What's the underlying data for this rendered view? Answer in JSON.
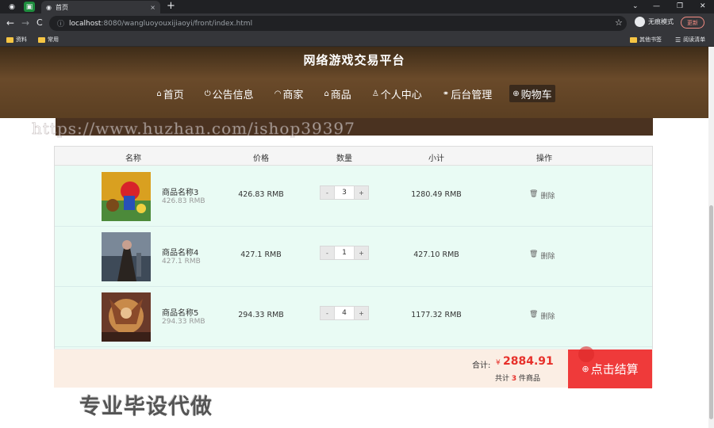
{
  "browser": {
    "tab_title": "首页",
    "tab_close": "×",
    "new_tab": "+",
    "url_host": "localhost",
    "url_path": ":8080/wangluoyouxijiaoyi/front/index.html",
    "star": "☆",
    "incognito_label": "无痕模式",
    "update_label": "更新",
    "window_controls": [
      "⌄",
      "—",
      "❐",
      "✕"
    ],
    "nav": {
      "back": "←",
      "forward": "→",
      "reload": "C",
      "info": "ⓘ"
    },
    "bookmarks": [
      {
        "label": "资料"
      },
      {
        "label": "常用"
      }
    ],
    "bookmarks_right": [
      {
        "label": "其他书签"
      },
      {
        "label": "阅读清单"
      }
    ]
  },
  "site": {
    "title": "网络游戏交易平台",
    "nav": [
      {
        "icon": "⌂",
        "label": "首页"
      },
      {
        "icon": "⏻",
        "label": "公告信息"
      },
      {
        "icon": "◠",
        "label": "商家"
      },
      {
        "icon": "⌂",
        "label": "商品"
      },
      {
        "icon": "♙",
        "label": "个人中心"
      },
      {
        "icon": "⚭",
        "label": "后台管理"
      },
      {
        "icon": "⊕",
        "label": "购物车"
      }
    ],
    "watermark": "https://www.huzhan.com/ishop39397"
  },
  "cart": {
    "headers": {
      "name": "名称",
      "price": "价格",
      "qty": "数量",
      "subtotal": "小计",
      "action": "操作"
    },
    "items": [
      {
        "name": "商品名称3",
        "unit": "426.83 RMB",
        "price": "426.83 RMB",
        "qty": "3",
        "subtotal": "1280.49 RMB",
        "delete": "删除",
        "minus": "-",
        "plus": "+"
      },
      {
        "name": "商品名称4",
        "unit": "427.1 RMB",
        "price": "427.1 RMB",
        "qty": "1",
        "subtotal": "427.10 RMB",
        "delete": "删除",
        "minus": "-",
        "plus": "+"
      },
      {
        "name": "商品名称5",
        "unit": "294.33 RMB",
        "price": "294.33 RMB",
        "qty": "4",
        "subtotal": "1177.32 RMB",
        "delete": "删除",
        "minus": "-",
        "plus": "+"
      }
    ],
    "footer": {
      "total_label": "合计:",
      "currency": "¥",
      "total": "2884.91",
      "count_prefix": "共计",
      "count": "3",
      "count_suffix": "件商品",
      "checkout_label": "点击结算"
    }
  },
  "page_watermark": "专业毕设代做",
  "colors": {
    "accent_red": "#ef3a3a",
    "header_brown": "#5b3f22",
    "row_bg": "#e9fbf4"
  }
}
